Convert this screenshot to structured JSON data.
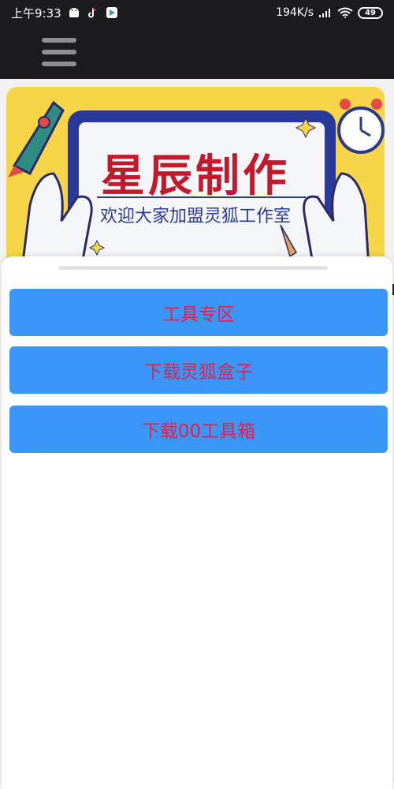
{
  "status_bar": {
    "time": "上午9:33",
    "network_speed": "194K/s",
    "battery": "49",
    "icons": [
      "android-icon",
      "tiktok-icon",
      "play-store-icon",
      "signal-icon",
      "wifi-icon",
      "battery-icon"
    ]
  },
  "app_bar": {
    "menu_icon": "hamburger-menu-icon"
  },
  "banner": {
    "title": "星辰制作",
    "subtitle": "欢迎大家加盟灵狐工作室"
  },
  "sheet": {
    "buttons": [
      {
        "label": "工具专区"
      },
      {
        "label": "下载灵狐盒子"
      },
      {
        "label": "下载00工具箱"
      }
    ]
  },
  "colors": {
    "status_bg": "#1c1c1e",
    "button_bg": "#3b97f7",
    "button_text": "#e0214a",
    "banner_bg": "#f7d548",
    "banner_title": "#c2192b"
  }
}
